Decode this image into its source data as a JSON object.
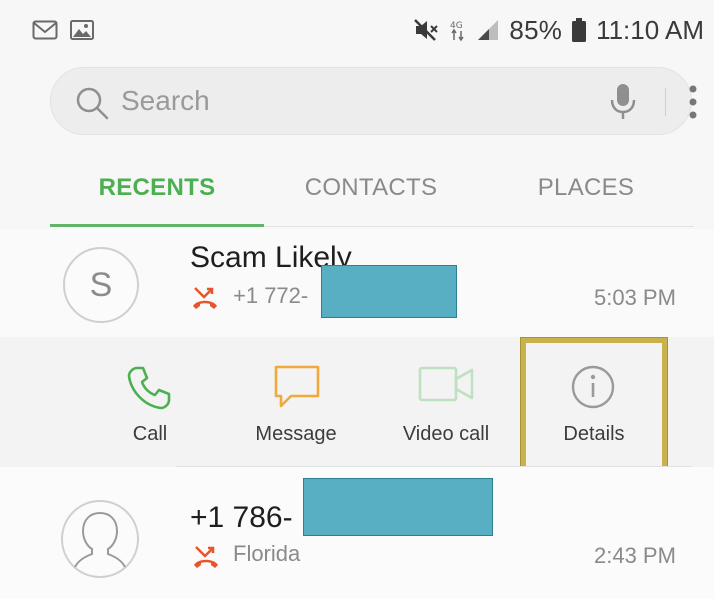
{
  "status_bar": {
    "notification_icons": [
      "gmail-icon",
      "image-icon"
    ],
    "system_icons": [
      "mute-icon",
      "data-icon",
      "signal-icon",
      "battery-icon"
    ],
    "battery": "85%",
    "time": "11:10 AM"
  },
  "search": {
    "placeholder": "Search",
    "icons": [
      "search-icon",
      "mic-icon",
      "more-vert-icon"
    ]
  },
  "tabs": [
    {
      "label": "RECENTS",
      "active": true
    },
    {
      "label": "CONTACTS",
      "active": false
    },
    {
      "label": "PLACES",
      "active": false
    }
  ],
  "calls": [
    {
      "avatar_letter": "S",
      "name": "Scam Likely",
      "number": "+1 772-",
      "time": "5:03 PM",
      "type": "missed",
      "redacted": true
    },
    {
      "name": "+1 786-",
      "location": "Florida",
      "time": "2:43 PM",
      "type": "missed",
      "redacted": true
    }
  ],
  "actions": [
    {
      "label": "Call",
      "icon": "phone-icon",
      "color": "#4caf50"
    },
    {
      "label": "Message",
      "icon": "message-icon",
      "color": "#f2a93b"
    },
    {
      "label": "Video call",
      "icon": "video-call-icon",
      "color": "#bfe0c1",
      "disabled": true
    },
    {
      "label": "Details",
      "icon": "info-icon",
      "color": "#9a9a9a",
      "highlighted": true
    }
  ],
  "colors": {
    "accent": "#4caf50",
    "missed_call": "#e8552b",
    "highlight_box": "#c9b24c",
    "redaction": "#58afc4"
  }
}
